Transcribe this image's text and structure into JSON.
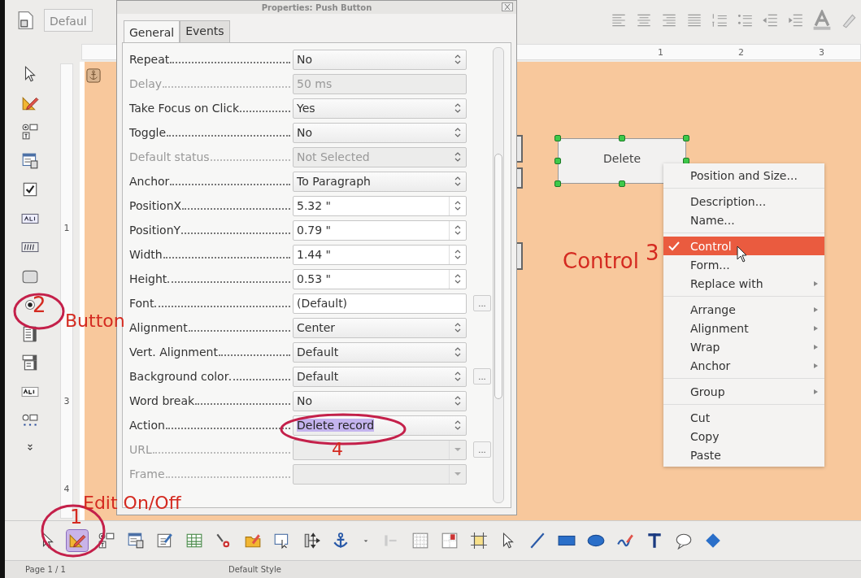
{
  "toolbar": {
    "paragraph_style": "Defaul",
    "design_mode_on": true
  },
  "ruler": {
    "horizontal_labels": [
      "1",
      "2",
      "3"
    ],
    "vertical_labels": [
      "1",
      "3",
      "4"
    ]
  },
  "dialog": {
    "title": "Properties: Push Button",
    "tabs": [
      {
        "label": "General",
        "selected": true
      },
      {
        "label": "Events",
        "selected": false
      }
    ],
    "properties": [
      {
        "label": "Repeat",
        "value": "No",
        "kind": "listbox",
        "disabled": false,
        "highlighted": false
      },
      {
        "label": "Delay",
        "value": "50 ms",
        "kind": "plain",
        "disabled": true,
        "highlighted": false
      },
      {
        "label": "Take Focus on Click",
        "value": "Yes",
        "kind": "listbox",
        "disabled": false,
        "highlighted": false
      },
      {
        "label": "Toggle",
        "value": "No",
        "kind": "listbox",
        "disabled": false,
        "highlighted": false
      },
      {
        "label": "Default status",
        "value": "Not Selected",
        "kind": "listbox",
        "disabled": true,
        "highlighted": false
      },
      {
        "label": "Anchor",
        "value": "To Paragraph",
        "kind": "listbox",
        "disabled": false,
        "highlighted": false
      },
      {
        "label": "PositionX",
        "value": "5.32 \"",
        "kind": "numeric",
        "disabled": false,
        "highlighted": false
      },
      {
        "label": "PositionY",
        "value": "0.79 \"",
        "kind": "numeric",
        "disabled": false,
        "highlighted": false
      },
      {
        "label": "Width",
        "value": "1.44 \"",
        "kind": "numeric",
        "disabled": false,
        "highlighted": false
      },
      {
        "label": "Height",
        "value": "0.53 \"",
        "kind": "numeric",
        "disabled": false,
        "highlighted": false
      },
      {
        "label": "Font",
        "value": "(Default)",
        "kind": "text",
        "disabled": false,
        "highlighted": false,
        "browse": "..."
      },
      {
        "label": "Alignment",
        "value": "Center",
        "kind": "listbox",
        "disabled": false,
        "highlighted": false
      },
      {
        "label": "Vert. Alignment",
        "value": "Default",
        "kind": "listbox",
        "disabled": false,
        "highlighted": false
      },
      {
        "label": "Background color",
        "value": "Default",
        "kind": "listbox",
        "disabled": false,
        "highlighted": false,
        "browse": "..."
      },
      {
        "label": "Word break",
        "value": "No",
        "kind": "listbox",
        "disabled": false,
        "highlighted": false
      },
      {
        "label": "Action",
        "value": "Delete record",
        "kind": "listbox",
        "disabled": false,
        "highlighted": true
      },
      {
        "label": "URL",
        "kind": "dropdown",
        "disabled": true,
        "highlighted": false,
        "browse": "..."
      },
      {
        "label": "Frame",
        "kind": "dropdown",
        "disabled": true,
        "highlighted": false
      }
    ]
  },
  "form_button": {
    "label": "Delete"
  },
  "context_menu": [
    {
      "kind": "item",
      "label": "Position and Size...",
      "submenu": false,
      "selected": false,
      "checked": false
    },
    {
      "kind": "separator"
    },
    {
      "kind": "item",
      "label": "Description...",
      "submenu": false,
      "selected": false,
      "checked": false
    },
    {
      "kind": "item",
      "label": "Name...",
      "submenu": false,
      "selected": false,
      "checked": false
    },
    {
      "kind": "separator"
    },
    {
      "kind": "item",
      "label": "Control",
      "submenu": false,
      "selected": true,
      "checked": true
    },
    {
      "kind": "item",
      "label": "Form...",
      "submenu": false,
      "selected": false,
      "checked": false
    },
    {
      "kind": "item",
      "label": "Replace with",
      "submenu": true,
      "selected": false,
      "checked": false
    },
    {
      "kind": "separator"
    },
    {
      "kind": "item",
      "label": "Arrange",
      "submenu": true,
      "selected": false,
      "checked": false
    },
    {
      "kind": "item",
      "label": "Alignment",
      "submenu": true,
      "selected": false,
      "checked": false
    },
    {
      "kind": "item",
      "label": "Wrap",
      "submenu": true,
      "selected": false,
      "checked": false
    },
    {
      "kind": "item",
      "label": "Anchor",
      "submenu": true,
      "selected": false,
      "checked": false
    },
    {
      "kind": "separator"
    },
    {
      "kind": "item",
      "label": "Group",
      "submenu": true,
      "selected": false,
      "checked": false
    },
    {
      "kind": "separator"
    },
    {
      "kind": "item",
      "label": "Cut",
      "submenu": false,
      "selected": false,
      "checked": false
    },
    {
      "kind": "item",
      "label": "Copy",
      "submenu": false,
      "selected": false,
      "checked": false
    },
    {
      "kind": "item",
      "label": "Paste",
      "submenu": false,
      "selected": false,
      "checked": false
    }
  ],
  "annotations": [
    {
      "number": "3",
      "label": "Control",
      "circled": false
    },
    {
      "number": "2",
      "label": "Button",
      "circled": true
    },
    {
      "number": "4",
      "circled": true
    },
    {
      "number": "1",
      "label": "Edit On/Off",
      "circled": true
    }
  ],
  "status_bar": {
    "page": "Page 1 / 1",
    "style": "Default Style"
  }
}
